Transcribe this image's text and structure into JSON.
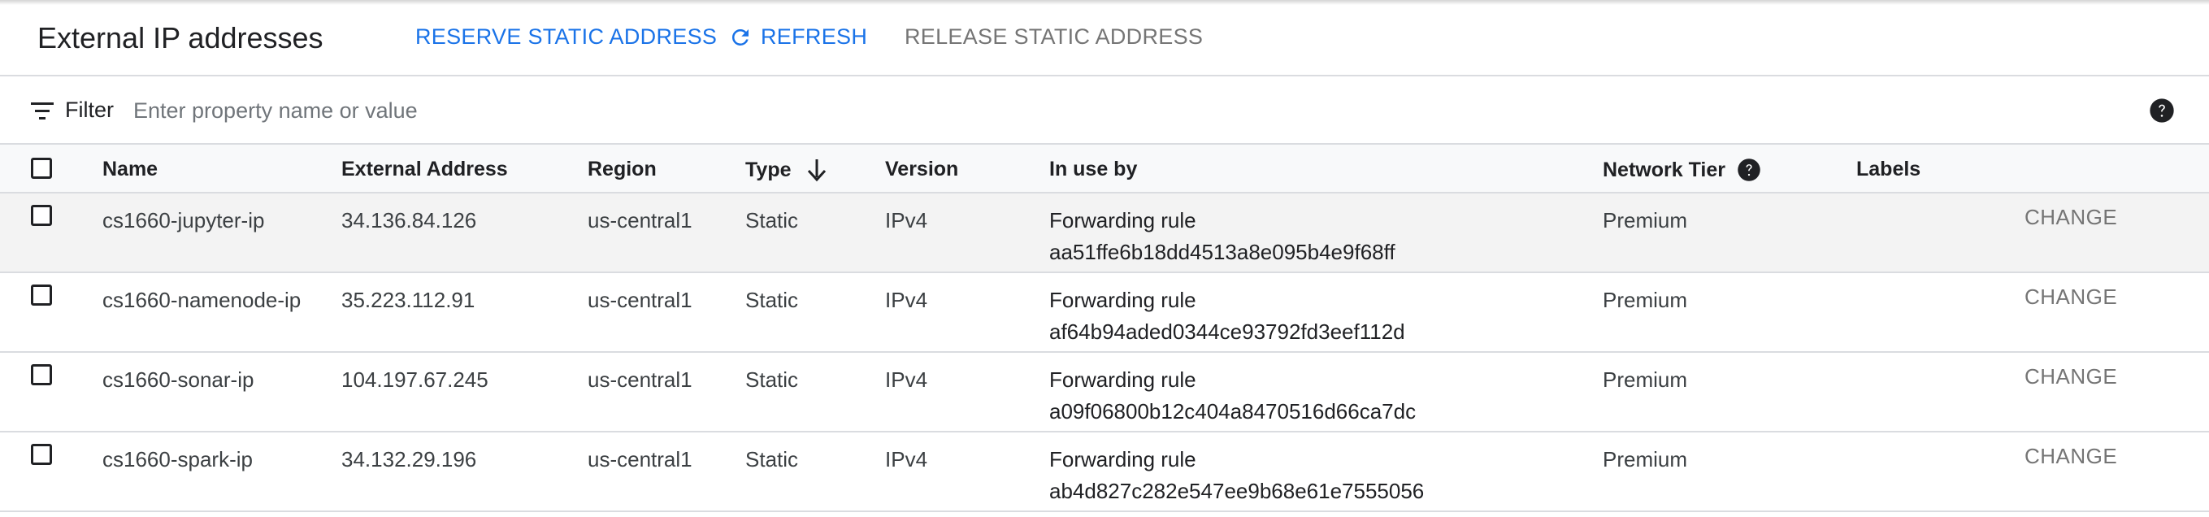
{
  "header": {
    "title": "External IP addresses",
    "reserve_label": "RESERVE STATIC ADDRESS",
    "refresh_label": "REFRESH",
    "release_label": "RELEASE STATIC ADDRESS"
  },
  "filter": {
    "label": "Filter",
    "placeholder": "Enter property name or value"
  },
  "columns": {
    "name": "Name",
    "external_address": "External Address",
    "region": "Region",
    "type": "Type",
    "version": "Version",
    "in_use_by": "In use by",
    "network_tier": "Network Tier",
    "labels": "Labels"
  },
  "rows": [
    {
      "name": "cs1660-jupyter-ip",
      "address": "34.136.84.126",
      "region": "us-central1",
      "type": "Static",
      "version": "IPv4",
      "in_use_by_kind": "Forwarding rule",
      "in_use_by_id": "aa51ffe6b18dd4513a8e095b4e9f68ff",
      "tier": "Premium",
      "action": "CHANGE"
    },
    {
      "name": "cs1660-namenode-ip",
      "address": "35.223.112.91",
      "region": "us-central1",
      "type": "Static",
      "version": "IPv4",
      "in_use_by_kind": "Forwarding rule",
      "in_use_by_id": "af64b94aded0344ce93792fd3eef112d",
      "tier": "Premium",
      "action": "CHANGE"
    },
    {
      "name": "cs1660-sonar-ip",
      "address": "104.197.67.245",
      "region": "us-central1",
      "type": "Static",
      "version": "IPv4",
      "in_use_by_kind": "Forwarding rule",
      "in_use_by_id": "a09f06800b12c404a8470516d66ca7dc",
      "tier": "Premium",
      "action": "CHANGE"
    },
    {
      "name": "cs1660-spark-ip",
      "address": "34.132.29.196",
      "region": "us-central1",
      "type": "Static",
      "version": "IPv4",
      "in_use_by_kind": "Forwarding rule",
      "in_use_by_id": "ab4d827c282e547ee9b68e61e7555056",
      "tier": "Premium",
      "action": "CHANGE"
    }
  ],
  "colors": {
    "accent": "#1a73e8",
    "disabled_text": "#757575",
    "border": "#dadce0",
    "header_bg": "#f8f9fa"
  },
  "icons": {
    "refresh": "refresh-icon",
    "filter": "filter-icon",
    "help": "help-icon",
    "sort": "arrow-down-icon"
  }
}
